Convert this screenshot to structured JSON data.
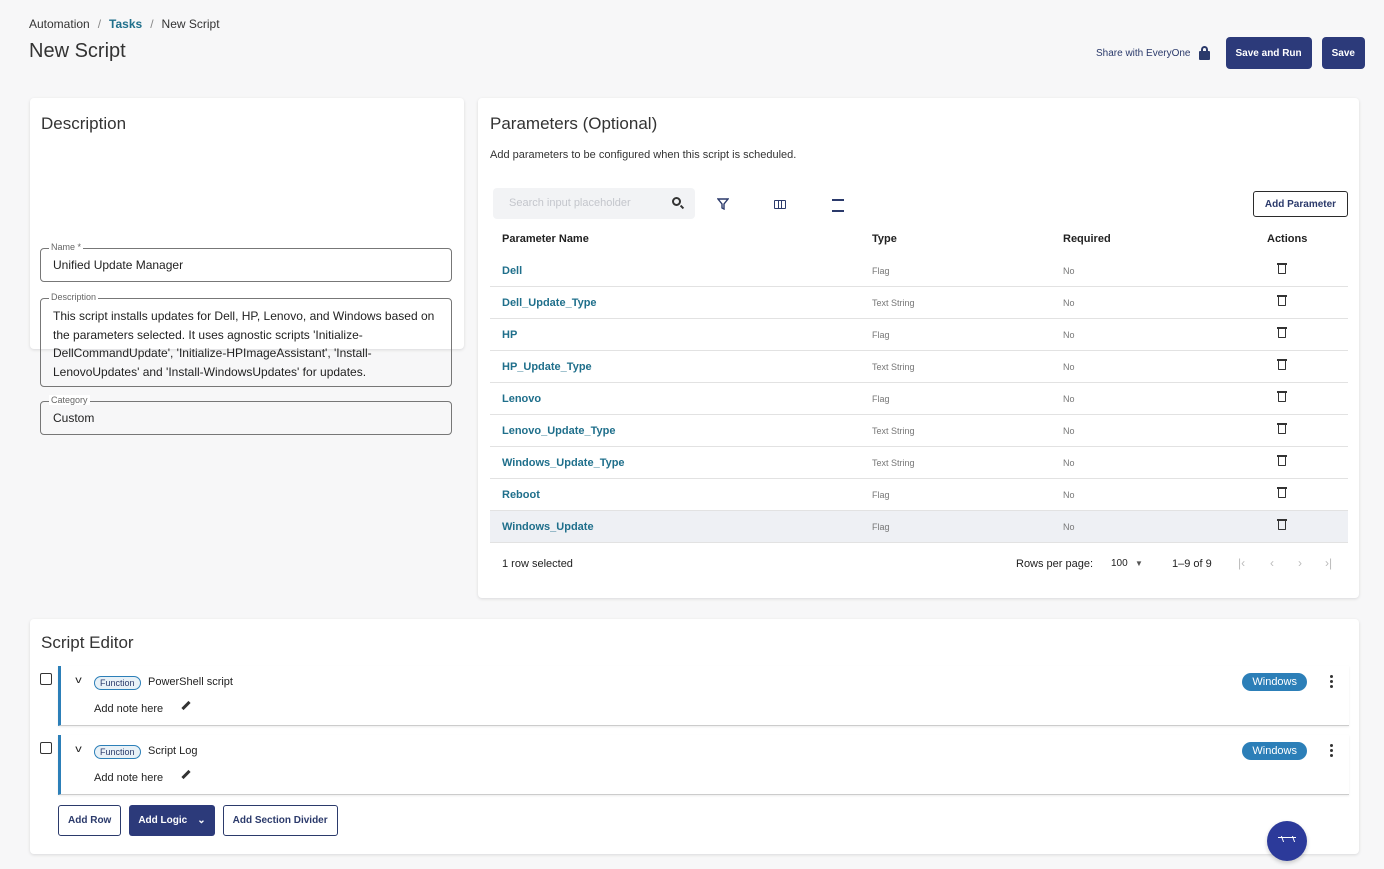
{
  "breadcrumb": {
    "root": "Automation",
    "parent": "Tasks",
    "current": "New Script",
    "sep": "/"
  },
  "page_title": "New Script",
  "top_actions": {
    "share_label": "Share with EveryOne",
    "save_run_label": "Save and Run",
    "save_label": "Save"
  },
  "description_card": {
    "title": "Description",
    "name_legend": "Name *",
    "name_value": "Unified Update Manager",
    "description_legend": "Description",
    "description_value": "This script installs updates for Dell, HP, Lenovo, and Windows based on the parameters selected. It uses agnostic scripts 'Initialize-DellCommandUpdate', 'Initialize-HPImageAssistant', 'Install-LenovoUpdates' and 'Install-WindowsUpdates' for updates.",
    "category_legend": "Category",
    "category_value": "Custom"
  },
  "parameters": {
    "title": "Parameters (Optional)",
    "subtitle": "Add parameters to be configured when this script is scheduled.",
    "search_placeholder": "Search input placeholder",
    "add_label": "Add Parameter",
    "columns": [
      "Parameter Name",
      "Type",
      "Required",
      "Actions"
    ],
    "rows": [
      {
        "name": "Dell",
        "type": "Flag",
        "required": "No"
      },
      {
        "name": "Dell_Update_Type",
        "type": "Text String",
        "required": "No"
      },
      {
        "name": "HP",
        "type": "Flag",
        "required": "No"
      },
      {
        "name": "HP_Update_Type",
        "type": "Text String",
        "required": "No"
      },
      {
        "name": "Lenovo",
        "type": "Flag",
        "required": "No"
      },
      {
        "name": "Lenovo_Update_Type",
        "type": "Text String",
        "required": "No"
      },
      {
        "name": "Windows_Update_Type",
        "type": "Text String",
        "required": "No"
      },
      {
        "name": "Reboot",
        "type": "Flag",
        "required": "No"
      },
      {
        "name": "Windows_Update",
        "type": "Flag",
        "required": "No"
      }
    ],
    "footer": {
      "selected": "1 row selected",
      "rows_per_page_label": "Rows per page:",
      "rows_per_page": "100",
      "range": "1–9 of 9"
    }
  },
  "editor": {
    "title": "Script Editor",
    "blocks": [
      {
        "badge": "Function",
        "title": "PowerShell script",
        "note": "Add note here",
        "os": "Windows"
      },
      {
        "badge": "Function",
        "title": "Script Log",
        "note": "Add note here",
        "os": "Windows"
      }
    ],
    "add_row": "Add Row",
    "add_logic": "Add Logic",
    "add_divider": "Add Section Divider"
  },
  "colors": {
    "primary": "#2c3a7a",
    "accent": "#2c7fb8",
    "link": "#1f6f8b"
  }
}
